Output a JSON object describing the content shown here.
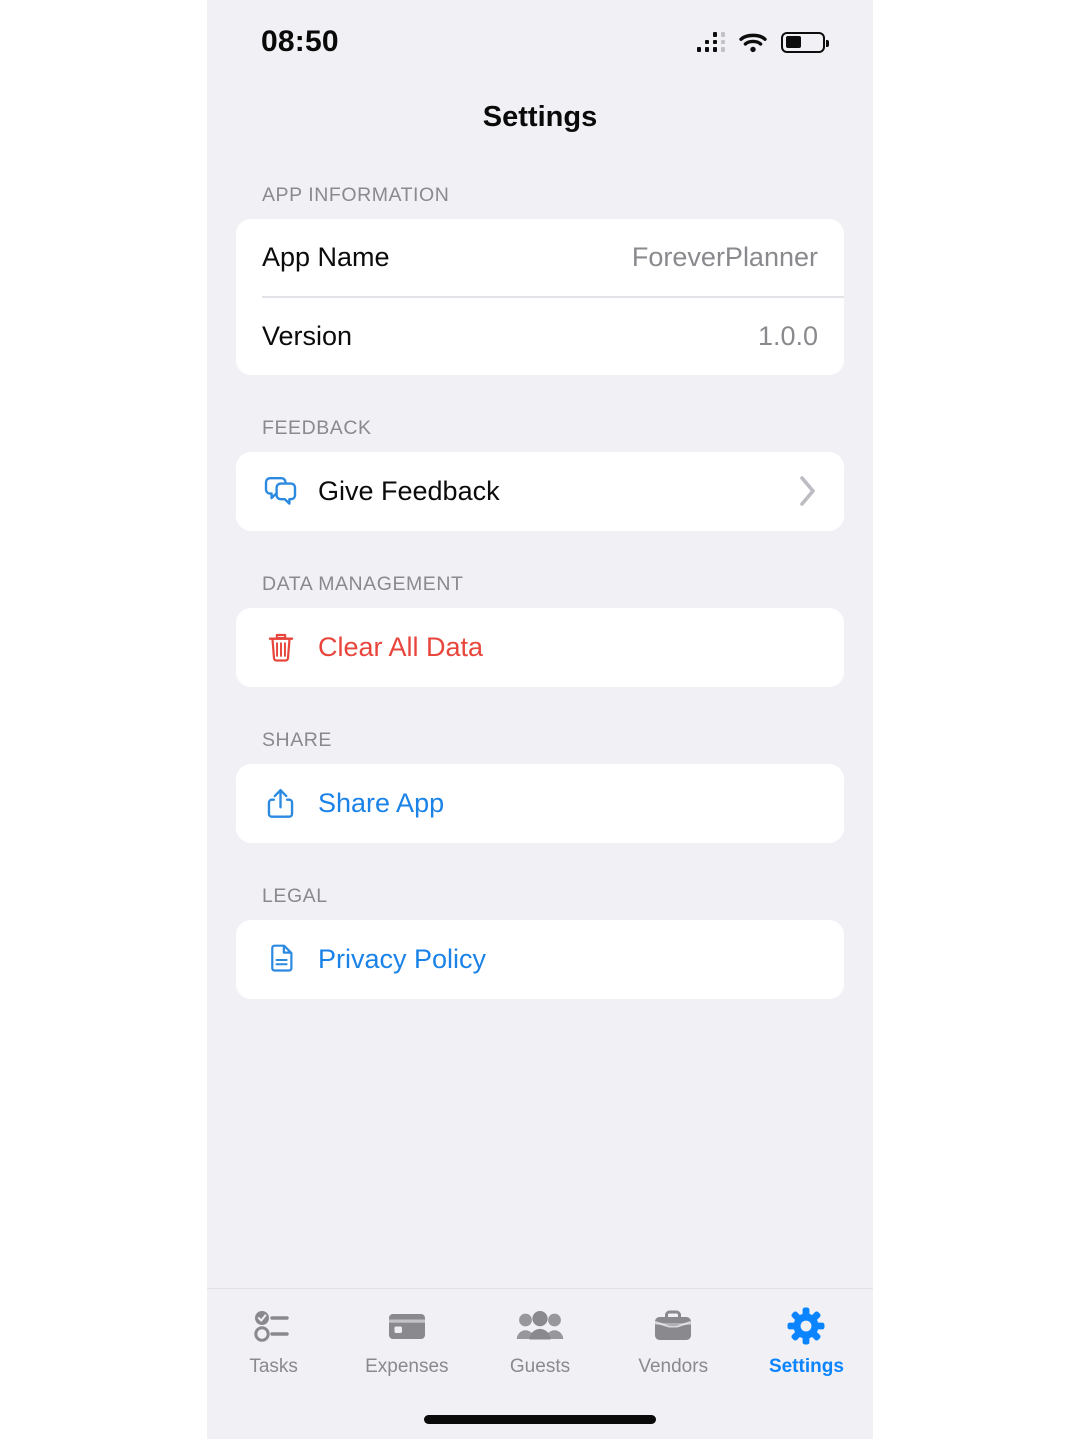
{
  "status_bar": {
    "time": "08:50",
    "signal_icon": "cellular-signal-icon",
    "wifi_icon": "wifi-icon",
    "battery_icon": "battery-icon",
    "battery_level_percent": 45
  },
  "nav": {
    "title": "Settings"
  },
  "colors": {
    "background": "#f0f0f5",
    "card": "#ffffff",
    "accent_blue": "#1b82e8",
    "tab_active_blue": "#0a84ff",
    "destructive_red": "#e8453c",
    "secondary_text": "#8a8a8e",
    "primary_text": "#0b0b0b"
  },
  "sections": [
    {
      "header": "APP INFORMATION",
      "rows": [
        {
          "label": "App Name",
          "value": "ForeverPlanner"
        },
        {
          "label": "Version",
          "value": "1.0.0"
        }
      ]
    },
    {
      "header": "FEEDBACK",
      "action": {
        "label": "Give Feedback",
        "icon": "chat-bubbles-icon",
        "chevron": true
      }
    },
    {
      "header": "DATA MANAGEMENT",
      "action": {
        "label": "Clear All Data",
        "icon": "trash-icon",
        "chevron": false
      }
    },
    {
      "header": "SHARE",
      "action": {
        "label": "Share App",
        "icon": "share-icon",
        "chevron": false
      }
    },
    {
      "header": "LEGAL",
      "action": {
        "label": "Privacy Policy",
        "icon": "document-icon",
        "chevron": false
      }
    }
  ],
  "tabs": [
    {
      "label": "Tasks",
      "icon": "checklist-icon",
      "active": false
    },
    {
      "label": "Expenses",
      "icon": "credit-card-icon",
      "active": false
    },
    {
      "label": "Guests",
      "icon": "people-group-icon",
      "active": false
    },
    {
      "label": "Vendors",
      "icon": "briefcase-icon",
      "active": false
    },
    {
      "label": "Settings",
      "icon": "gear-icon",
      "active": true
    }
  ]
}
